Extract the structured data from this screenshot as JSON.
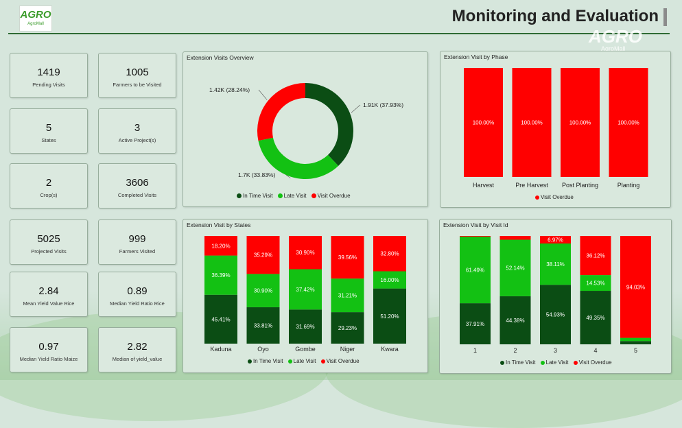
{
  "header": {
    "logo_text": "AGRO",
    "logo_sub": "AgroMall",
    "title": "Monitoring and Evaluation",
    "watermark_logo": "AGRO",
    "watermark_sub": "AgroMall"
  },
  "kpis": [
    {
      "value": "1419",
      "label": "Pending Visits"
    },
    {
      "value": "1005",
      "label": "Farmers to be Visited"
    },
    {
      "value": "5",
      "label": "States"
    },
    {
      "value": "3",
      "label": "Active Project(s)"
    },
    {
      "value": "2",
      "label": "Crop(s)"
    },
    {
      "value": "3606",
      "label": "Completed Visits"
    },
    {
      "value": "5025",
      "label": "Projected Visits"
    },
    {
      "value": "999",
      "label": "Farmers Visited"
    },
    {
      "value": "2.84",
      "label": "Mean Yield Value Rice"
    },
    {
      "value": "0.89",
      "label": "Median Yield Ratio Rice"
    },
    {
      "value": "0.97",
      "label": "Median Yield Ratio Maize"
    },
    {
      "value": "2.82",
      "label": "Median of yield_value"
    }
  ],
  "colors": {
    "in_time": "#0b4d14",
    "late": "#13c113",
    "overdue": "#ff0000"
  },
  "legend_labels": {
    "in_time": "In Time Visit",
    "late": "Late Visit",
    "overdue": "Visit Overdue"
  },
  "chart_data": [
    {
      "id": "overview",
      "type": "pie",
      "title": "Extension Visits Overview",
      "slices": [
        {
          "name": "In Time Visit",
          "value": 1910,
          "percent": 37.93,
          "label": "1.91K (37.93%)"
        },
        {
          "name": "Late Visit",
          "value": 1700,
          "percent": 33.83,
          "label": "1.7K (33.83%)"
        },
        {
          "name": "Visit Overdue",
          "value": 1420,
          "percent": 28.24,
          "label": "1.42K (28.24%)"
        }
      ]
    },
    {
      "id": "phase",
      "type": "bar",
      "stacked": "percent",
      "title": "Extension Visit by Phase",
      "categories": [
        "Harvest",
        "Pre Harvest",
        "Post Planting",
        "Planting"
      ],
      "series": [
        {
          "name": "Visit Overdue",
          "values": [
            100.0,
            100.0,
            100.0,
            100.0
          ],
          "labels": [
            "100.00%",
            "100.00%",
            "100.00%",
            "100.00%"
          ]
        }
      ],
      "legend": [
        "Visit Overdue"
      ]
    },
    {
      "id": "states",
      "type": "bar",
      "stacked": "percent",
      "title": "Extension Visit by States",
      "categories": [
        "Kaduna",
        "Oyo",
        "Gombe",
        "Niger",
        "Kwara"
      ],
      "series": [
        {
          "name": "In Time Visit",
          "values": [
            45.41,
            33.81,
            31.69,
            29.23,
            51.2
          ],
          "labels": [
            "45.41%",
            "33.81%",
            "31.69%",
            "29.23%",
            "51.20%"
          ]
        },
        {
          "name": "Late Visit",
          "values": [
            36.39,
            30.9,
            37.42,
            31.21,
            16.0
          ],
          "labels": [
            "36.39%",
            "30.90%",
            "37.42%",
            "31.21%",
            "16.00%"
          ]
        },
        {
          "name": "Visit Overdue",
          "values": [
            18.2,
            35.29,
            30.9,
            39.56,
            32.8
          ],
          "labels": [
            "18.20%",
            "35.29%",
            "30.90%",
            "39.56%",
            "32.80%"
          ]
        }
      ]
    },
    {
      "id": "visitid",
      "type": "bar",
      "stacked": "percent",
      "title": "Extension Visit by Visit Id",
      "categories": [
        "1",
        "2",
        "3",
        "4",
        "5"
      ],
      "series": [
        {
          "name": "In Time Visit",
          "values": [
            37.91,
            44.38,
            54.93,
            49.35,
            3.0
          ],
          "labels": [
            "37.91%",
            "44.38%",
            "54.93%",
            "49.35%",
            ""
          ]
        },
        {
          "name": "Late Visit",
          "values": [
            61.49,
            52.14,
            38.11,
            14.53,
            2.97
          ],
          "labels": [
            "61.49%",
            "52.14%",
            "38.11%",
            "14.53%",
            ""
          ]
        },
        {
          "name": "Visit Overdue",
          "values": [
            0.6,
            3.48,
            6.97,
            36.12,
            94.03
          ],
          "labels": [
            "",
            "",
            "6.97%",
            "36.12%",
            "94.03%"
          ]
        }
      ]
    }
  ]
}
